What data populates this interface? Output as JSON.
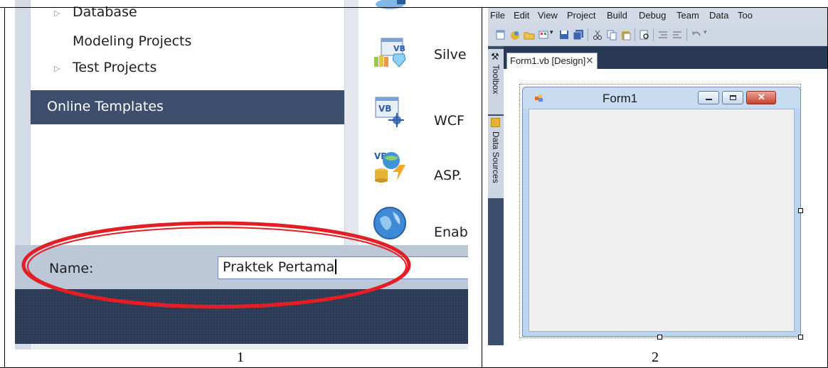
{
  "panel1": {
    "tree_items": [
      "Database",
      "Modeling Projects",
      "Test Projects"
    ],
    "online_templates": "Online Templates",
    "templates": [
      {
        "label": "Silve",
        "icon": "vb-silverlight-icon"
      },
      {
        "label": "WCF",
        "icon": "vb-wcf-icon"
      },
      {
        "label": "ASP.",
        "icon": "vb-asp-icon"
      },
      {
        "label": "Enab",
        "icon": "globe-icon"
      }
    ],
    "name_label": "Name:",
    "name_value": "Praktek Pertama",
    "caption": "1",
    "colors": {
      "selected_bg": "#3e4f6e",
      "ellipse": "#e31e24"
    }
  },
  "panel2": {
    "menu": [
      "File",
      "Edit",
      "View",
      "Project",
      "Build",
      "Debug",
      "Team",
      "Data",
      "Too"
    ],
    "side_tabs": [
      "Toolbox",
      "Data Sources"
    ],
    "doc_tab": "Form1.vb [Design]",
    "doc_tab_close": "✕",
    "form_title": "Form1",
    "caption": "2"
  }
}
